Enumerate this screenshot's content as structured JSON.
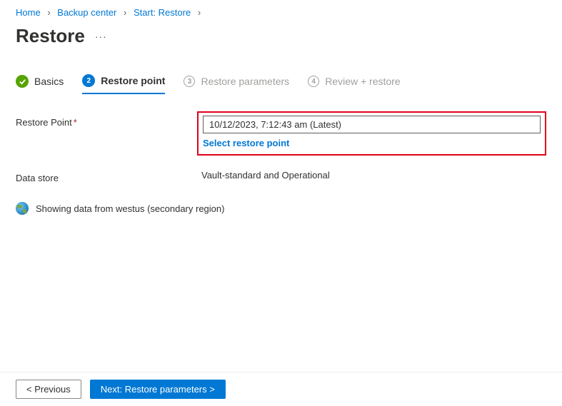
{
  "breadcrumb": {
    "items": [
      "Home",
      "Backup center",
      "Start: Restore"
    ]
  },
  "page": {
    "title": "Restore"
  },
  "tabs": {
    "basics": "Basics",
    "restore_point": "Restore point",
    "restore_params": "Restore parameters",
    "review": "Review + restore",
    "num3": "3",
    "num4": "4"
  },
  "form": {
    "restore_point_label": "Restore Point",
    "restore_point_value": "10/12/2023, 7:12:43 am (Latest)",
    "select_restore_point": "Select restore point",
    "data_store_label": "Data store",
    "data_store_value": "Vault-standard and Operational"
  },
  "info": {
    "region_text": "Showing data from westus (secondary region)"
  },
  "footer": {
    "previous": "< Previous",
    "next": "Next: Restore parameters >"
  }
}
